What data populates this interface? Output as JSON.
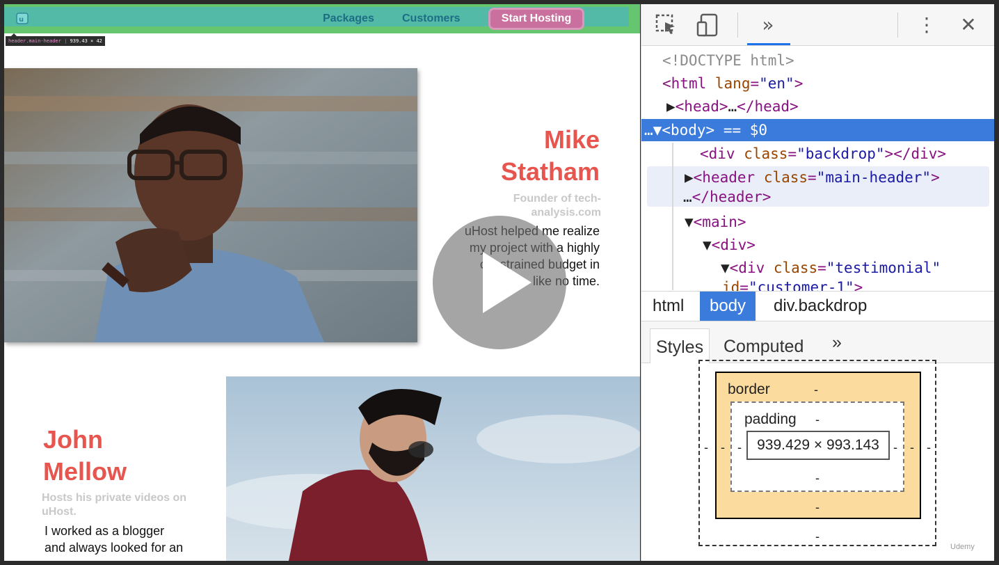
{
  "page": {
    "nav": {
      "packages": "Packages",
      "customers": "Customers",
      "cta": "Start Hosting"
    },
    "tooltip": {
      "selector": "header.main-header",
      "size": "939.43 × 42"
    },
    "testimonials": [
      {
        "name_line1": "Mike",
        "name_line2": "Statham",
        "role_line1": "Founder of tech-",
        "role_line2": "analysis.com",
        "text_lines": [
          "uHost helped me realize",
          "my project with a highly",
          "constrained budget in",
          "like no time."
        ]
      },
      {
        "name_line1": "John",
        "name_line2": "Mellow",
        "role_line1": "Hosts his private videos on",
        "role_line2": "uHost.",
        "text_lines": [
          "I worked as a blogger",
          "and always looked for an"
        ]
      }
    ]
  },
  "devtools": {
    "toolbar": {
      "inspect_icon": "inspect-element-icon",
      "device_icon": "device-toolbar-icon",
      "more_tabs": "»",
      "menu": "⋮",
      "close": "✕"
    },
    "elements": {
      "doctype": "<!DOCTYPE html>",
      "html_open": "html",
      "html_attr": "lang",
      "html_val": "\"en\"",
      "head_collapsed": "…",
      "body_prefix": "…",
      "body_suffix": " == $0",
      "div_backdrop_attr": "class",
      "div_backdrop_val": "\"backdrop\"",
      "header_attr": "class",
      "header_val": "\"main-header\"",
      "header_ellipsis": "…",
      "testimonial_val": "\"testimonial\"",
      "testimonial_id": "\"customer-1\""
    },
    "breadcrumbs": [
      "html",
      "body",
      "div.backdrop"
    ],
    "styles_tabs": {
      "styles": "Styles",
      "computed": "Computed",
      "more": "»"
    },
    "box_model": {
      "border_label": "border",
      "padding_label": "padding",
      "content_size": "939.429 × 993.143",
      "dash": "-"
    }
  },
  "watermark": "Udemy"
}
